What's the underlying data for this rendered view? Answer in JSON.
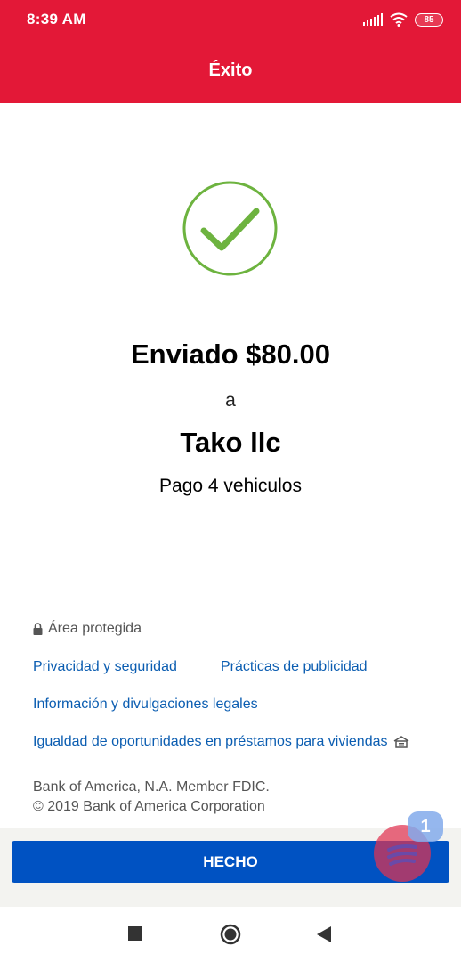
{
  "status_bar": {
    "time": "8:39 AM",
    "battery": "85",
    "icons": [
      "signal-icon",
      "wifi-icon",
      "battery-icon"
    ]
  },
  "header": {
    "title": "Éxito"
  },
  "confirmation": {
    "icon": "checkmark-circle-icon",
    "amount_line": "Enviado $80.00",
    "to_word": "a",
    "recipient": "Tako llc",
    "memo": "Pago 4 vehiculos"
  },
  "footer": {
    "secure_area": "Área protegida",
    "links": {
      "privacy": "Privacidad y seguridad",
      "advertising": "Prácticas de publicidad",
      "legal": "Información y divulgaciones legales",
      "housing": "Igualdad de oportunidades en préstamos para viviendas"
    },
    "legal_line_1": "Bank of America, N.A. Member FDIC.",
    "legal_line_2": "© 2019 Bank of America Corporation"
  },
  "actions": {
    "done_label": "HECHO"
  },
  "chat": {
    "badge_count": "1"
  },
  "colors": {
    "brand_red": "#e31837",
    "button_blue": "#0052c2",
    "link_blue": "#0b5db1",
    "success_green": "#6db33f"
  },
  "nav_bar": {
    "icons": [
      "recents-icon",
      "home-icon",
      "back-icon"
    ]
  }
}
